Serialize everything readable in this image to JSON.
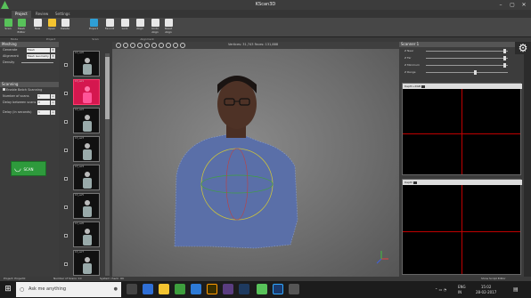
{
  "window": {
    "title": "KScan3D"
  },
  "ribbon_tabs": [
    "Project",
    "Review",
    "Settings"
  ],
  "ribbon_buttons": [
    {
      "label": "Scan",
      "color": "#58c25a"
    },
    {
      "label": "Mesh Editor",
      "color": "#58c25a"
    },
    {
      "label": "New",
      "color": "#e7e7e7"
    },
    {
      "label": "Open",
      "color": "#f4c430"
    },
    {
      "label": "Delete",
      "color": "#e7e7e7"
    },
    {
      "label": "Export",
      "color": "#2f9fd6"
    },
    {
      "label": "Favorit",
      "color": "#e7e7e7"
    },
    {
      "label": "Lock",
      "color": "#e7e7e7"
    },
    {
      "label": "Align",
      "color": "#e7e7e7"
    },
    {
      "label": "Undo Align",
      "color": "#e7e7e7"
    },
    {
      "label": "Reset Align",
      "color": "#e7e7e7"
    }
  ],
  "ribbon_groups": [
    "Mode",
    "Project",
    "Scan",
    "Alignment"
  ],
  "left_panel": {
    "meshing_header": "Meshing",
    "scanning_header": "Scanning",
    "fields": [
      {
        "label": "Generate",
        "value": "Mesh"
      },
      {
        "label": "Alignment",
        "value": "Mesh Geometry"
      },
      {
        "label": "Density",
        "value": ""
      }
    ],
    "checkbox_label": "Enable Batch Scanning",
    "scan_fields": [
      {
        "label": "Number of scans",
        "value": "1"
      },
      {
        "label": "Delay between scans",
        "value": "0"
      },
      {
        "label": "Delay (in seconds)",
        "value": "1"
      }
    ],
    "scan_button": "SCAN"
  },
  "thumbnails": [
    "13_sur0",
    "13_sur1",
    "13_sur2",
    "13_sur3",
    "13_sur4",
    "13_sur5",
    "13_sur6",
    "13_sur7"
  ],
  "viewport": {
    "readout": "Vertices: 31,743    Faces: 131,888"
  },
  "right_panel": {
    "header": "Scanner 1",
    "sliders": [
      {
        "label": "Z Near",
        "level": 0.96
      },
      {
        "label": "Z Far",
        "level": 0.96
      },
      {
        "label": "Z Minimum",
        "level": 0.96
      },
      {
        "label": "Z Range",
        "level": 0.6
      }
    ],
    "depth_label_1": "Depth+RGB",
    "depth_label_2": "Depth"
  },
  "statusbar": {
    "project": "Project:  Project0",
    "scans": "Number of Scans:  10",
    "system": "System check: OK",
    "right": "Show Script Editor"
  },
  "taskbar": {
    "search_placeholder": "Ask me anything",
    "language": "ENG",
    "region": "IN",
    "time": "15:02",
    "date": "28-02-2017"
  }
}
